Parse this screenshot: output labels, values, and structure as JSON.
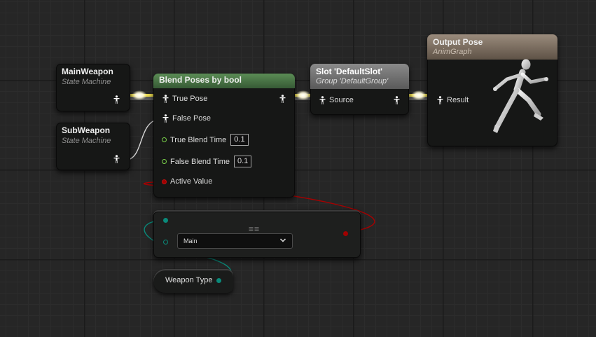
{
  "nodes": {
    "main_weapon": {
      "title": "MainWeapon",
      "subtitle": "State Machine"
    },
    "sub_weapon": {
      "title": "SubWeapon",
      "subtitle": "State Machine"
    },
    "blend": {
      "title": "Blend Poses by bool",
      "true_pose": "True Pose",
      "false_pose": "False Pose",
      "true_blend_time": "True Blend Time",
      "true_blend_value": "0.1",
      "false_blend_time": "False Blend Time",
      "false_blend_value": "0.1",
      "active_value": "Active Value"
    },
    "slot": {
      "title": "Slot 'DefaultSlot'",
      "subtitle": "Group 'DefaultGroup'",
      "source": "Source"
    },
    "output": {
      "title": "Output Pose",
      "subtitle": "AnimGraph",
      "result": "Result"
    },
    "equals": {
      "operator": "==",
      "selected": "Main"
    },
    "weapon_type": {
      "label": "Weapon Type"
    }
  },
  "colors": {
    "pose_wire": "#f5e36a",
    "bool_pin": "#a00000",
    "float_pin": "#7ad14a",
    "enum_pin": "#0a8a7a",
    "blend_header": "#4d7a48",
    "slot_header": "#767676",
    "output_header": "#86786a"
  },
  "icons": {
    "pose_pin": "person-pose-icon",
    "dropdown": "chevron-down-icon",
    "output_figure": "running-mannequin-icon"
  }
}
